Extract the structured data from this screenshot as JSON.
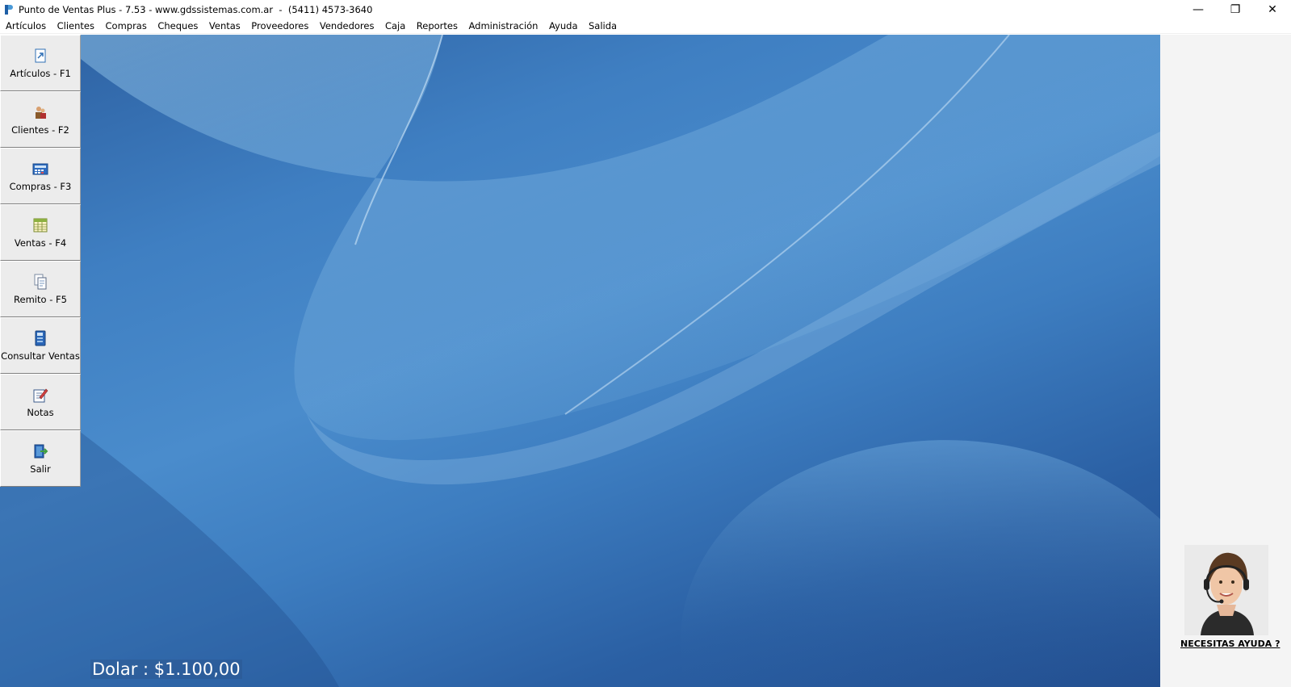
{
  "window": {
    "title": "Punto de Ventas Plus - 7.53 - www.gdssistemas.com.ar  -  (5411) 4573-3640",
    "controls": {
      "minimize": "—",
      "restore": "❐",
      "close": "✕"
    }
  },
  "menu": [
    "Artículos",
    "Clientes",
    "Compras",
    "Cheques",
    "Ventas",
    "Proveedores",
    "Vendedores",
    "Caja",
    "Reportes",
    "Administración",
    "Ayuda",
    "Salida"
  ],
  "toolbar": [
    {
      "label": "Artículos - F1",
      "icon": "document-arrow-icon"
    },
    {
      "label": "Clientes - F2",
      "icon": "users-icon"
    },
    {
      "label": "Compras - F3",
      "icon": "calculator-icon"
    },
    {
      "label": "Ventas - F4",
      "icon": "spreadsheet-icon"
    },
    {
      "label": "Remito - F5",
      "icon": "documents-icon"
    },
    {
      "label": "Consultar Ventas",
      "icon": "book-icon"
    },
    {
      "label": "Notas",
      "icon": "pencil-note-icon"
    },
    {
      "label": "Salir",
      "icon": "exit-door-icon"
    }
  ],
  "status": {
    "dolar": "Dolar : $1.100,00"
  },
  "support": {
    "link": "NECESITAS AYUDA ?"
  },
  "colors": {
    "desktop_base": "#3f7fc2",
    "panel_bg": "#f4f4f4",
    "button_bg": "#ececec"
  }
}
